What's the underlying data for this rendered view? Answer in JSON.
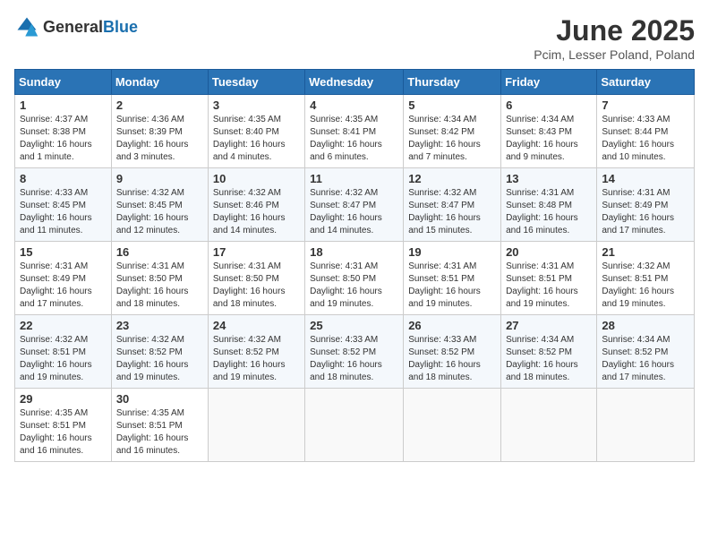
{
  "header": {
    "logo_general": "General",
    "logo_blue": "Blue",
    "title": "June 2025",
    "subtitle": "Pcim, Lesser Poland, Poland"
  },
  "weekdays": [
    "Sunday",
    "Monday",
    "Tuesday",
    "Wednesday",
    "Thursday",
    "Friday",
    "Saturday"
  ],
  "weeks": [
    [
      {
        "day": "1",
        "sunrise": "4:37 AM",
        "sunset": "8:38 PM",
        "daylight": "16 hours and 1 minute."
      },
      {
        "day": "2",
        "sunrise": "4:36 AM",
        "sunset": "8:39 PM",
        "daylight": "16 hours and 3 minutes."
      },
      {
        "day": "3",
        "sunrise": "4:35 AM",
        "sunset": "8:40 PM",
        "daylight": "16 hours and 4 minutes."
      },
      {
        "day": "4",
        "sunrise": "4:35 AM",
        "sunset": "8:41 PM",
        "daylight": "16 hours and 6 minutes."
      },
      {
        "day": "5",
        "sunrise": "4:34 AM",
        "sunset": "8:42 PM",
        "daylight": "16 hours and 7 minutes."
      },
      {
        "day": "6",
        "sunrise": "4:34 AM",
        "sunset": "8:43 PM",
        "daylight": "16 hours and 9 minutes."
      },
      {
        "day": "7",
        "sunrise": "4:33 AM",
        "sunset": "8:44 PM",
        "daylight": "16 hours and 10 minutes."
      }
    ],
    [
      {
        "day": "8",
        "sunrise": "4:33 AM",
        "sunset": "8:45 PM",
        "daylight": "16 hours and 11 minutes."
      },
      {
        "day": "9",
        "sunrise": "4:32 AM",
        "sunset": "8:45 PM",
        "daylight": "16 hours and 12 minutes."
      },
      {
        "day": "10",
        "sunrise": "4:32 AM",
        "sunset": "8:46 PM",
        "daylight": "16 hours and 14 minutes."
      },
      {
        "day": "11",
        "sunrise": "4:32 AM",
        "sunset": "8:47 PM",
        "daylight": "16 hours and 14 minutes."
      },
      {
        "day": "12",
        "sunrise": "4:32 AM",
        "sunset": "8:47 PM",
        "daylight": "16 hours and 15 minutes."
      },
      {
        "day": "13",
        "sunrise": "4:31 AM",
        "sunset": "8:48 PM",
        "daylight": "16 hours and 16 minutes."
      },
      {
        "day": "14",
        "sunrise": "4:31 AM",
        "sunset": "8:49 PM",
        "daylight": "16 hours and 17 minutes."
      }
    ],
    [
      {
        "day": "15",
        "sunrise": "4:31 AM",
        "sunset": "8:49 PM",
        "daylight": "16 hours and 17 minutes."
      },
      {
        "day": "16",
        "sunrise": "4:31 AM",
        "sunset": "8:50 PM",
        "daylight": "16 hours and 18 minutes."
      },
      {
        "day": "17",
        "sunrise": "4:31 AM",
        "sunset": "8:50 PM",
        "daylight": "16 hours and 18 minutes."
      },
      {
        "day": "18",
        "sunrise": "4:31 AM",
        "sunset": "8:50 PM",
        "daylight": "16 hours and 19 minutes."
      },
      {
        "day": "19",
        "sunrise": "4:31 AM",
        "sunset": "8:51 PM",
        "daylight": "16 hours and 19 minutes."
      },
      {
        "day": "20",
        "sunrise": "4:31 AM",
        "sunset": "8:51 PM",
        "daylight": "16 hours and 19 minutes."
      },
      {
        "day": "21",
        "sunrise": "4:32 AM",
        "sunset": "8:51 PM",
        "daylight": "16 hours and 19 minutes."
      }
    ],
    [
      {
        "day": "22",
        "sunrise": "4:32 AM",
        "sunset": "8:51 PM",
        "daylight": "16 hours and 19 minutes."
      },
      {
        "day": "23",
        "sunrise": "4:32 AM",
        "sunset": "8:52 PM",
        "daylight": "16 hours and 19 minutes."
      },
      {
        "day": "24",
        "sunrise": "4:32 AM",
        "sunset": "8:52 PM",
        "daylight": "16 hours and 19 minutes."
      },
      {
        "day": "25",
        "sunrise": "4:33 AM",
        "sunset": "8:52 PM",
        "daylight": "16 hours and 18 minutes."
      },
      {
        "day": "26",
        "sunrise": "4:33 AM",
        "sunset": "8:52 PM",
        "daylight": "16 hours and 18 minutes."
      },
      {
        "day": "27",
        "sunrise": "4:34 AM",
        "sunset": "8:52 PM",
        "daylight": "16 hours and 18 minutes."
      },
      {
        "day": "28",
        "sunrise": "4:34 AM",
        "sunset": "8:52 PM",
        "daylight": "16 hours and 17 minutes."
      }
    ],
    [
      {
        "day": "29",
        "sunrise": "4:35 AM",
        "sunset": "8:51 PM",
        "daylight": "16 hours and 16 minutes."
      },
      {
        "day": "30",
        "sunrise": "4:35 AM",
        "sunset": "8:51 PM",
        "daylight": "16 hours and 16 minutes."
      },
      null,
      null,
      null,
      null,
      null
    ]
  ]
}
